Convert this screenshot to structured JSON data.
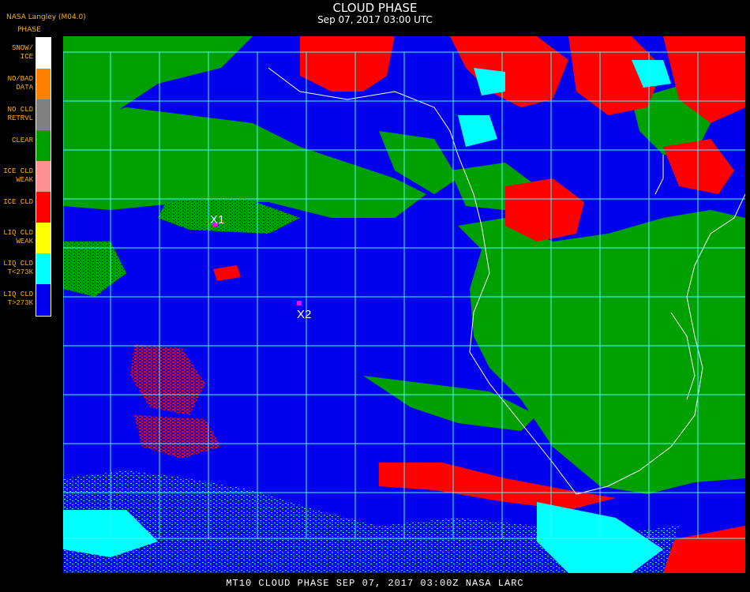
{
  "header": {
    "title": "CLOUD PHASE",
    "datetime": "Sep 07, 2017 03:00 UTC",
    "producer": "NASA Langley (M04.0)"
  },
  "legend": {
    "title": "PHASE",
    "items": [
      {
        "line1": "SNOW/",
        "line2": "ICE",
        "color": "#ffffff"
      },
      {
        "line1": "NO/BAD",
        "line2": "DATA",
        "color": "#ff8000"
      },
      {
        "line1": "NO CLD",
        "line2": "RETRVL",
        "color": "#808080"
      },
      {
        "line1": "CLEAR",
        "line2": "",
        "color": "#00a000"
      },
      {
        "line1": "ICE CLD",
        "line2": "WEAK",
        "color": "#ff9090"
      },
      {
        "line1": "ICE CLD",
        "line2": "",
        "color": "#ff0000"
      },
      {
        "line1": "LIQ CLD",
        "line2": "WEAK",
        "color": "#ffff00"
      },
      {
        "line1": "LIQ CLD",
        "line2": "T<273K",
        "color": "#00ffff"
      },
      {
        "line1": "LIQ CLD",
        "line2": "T>273K",
        "color": "#0000ee"
      }
    ]
  },
  "markers": [
    {
      "label": "X1",
      "color": "#ff00ff"
    },
    {
      "label": "X2",
      "color": "#ff00ff"
    }
  ],
  "footer": {
    "text": "MT10  CLOUD PHASE  SEP 07, 2017 03:00Z  NASA LARC"
  },
  "map": {
    "grid_color": "#40ffff",
    "coast_color": "#ffffff"
  }
}
